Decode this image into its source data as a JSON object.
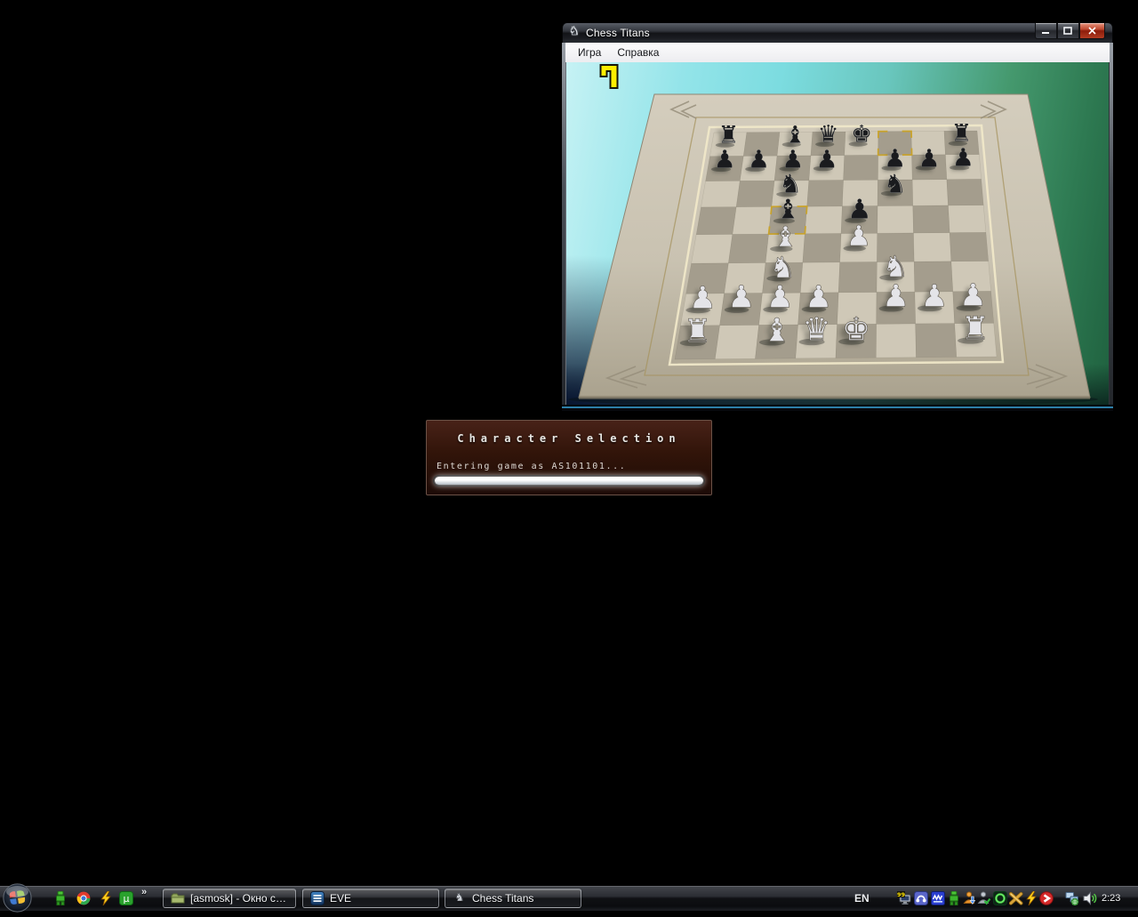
{
  "chess_window": {
    "title": "Chess Titans",
    "window_icon": "knight-icon",
    "menu_items": [
      {
        "label": "Игра"
      },
      {
        "label": "Справка"
      }
    ],
    "caption_buttons": [
      "minimize",
      "maximize",
      "close"
    ],
    "board": {
      "colors": {
        "light_square": "#cfc8b7",
        "dark_square": "#a49d8d",
        "table": "#c9c2b1",
        "frame_line": "#a5935f",
        "inner_line": "#efe7c8",
        "highlight_gold": "#c9a227"
      },
      "last_move_highlights": [
        "c5",
        "f8"
      ],
      "pieces": [
        {
          "square": "a1",
          "color": "white",
          "type": "rook"
        },
        {
          "square": "c1",
          "color": "white",
          "type": "bishop"
        },
        {
          "square": "d1",
          "color": "white",
          "type": "queen"
        },
        {
          "square": "e1",
          "color": "white",
          "type": "king"
        },
        {
          "square": "h1",
          "color": "white",
          "type": "rook"
        },
        {
          "square": "a2",
          "color": "white",
          "type": "pawn"
        },
        {
          "square": "b2",
          "color": "white",
          "type": "pawn"
        },
        {
          "square": "c2",
          "color": "white",
          "type": "pawn"
        },
        {
          "square": "d2",
          "color": "white",
          "type": "pawn"
        },
        {
          "square": "f2",
          "color": "white",
          "type": "pawn"
        },
        {
          "square": "g2",
          "color": "white",
          "type": "pawn"
        },
        {
          "square": "h2",
          "color": "white",
          "type": "pawn"
        },
        {
          "square": "c3",
          "color": "white",
          "type": "knight"
        },
        {
          "square": "f3",
          "color": "white",
          "type": "knight"
        },
        {
          "square": "c4",
          "color": "white",
          "type": "bishop"
        },
        {
          "square": "e4",
          "color": "white",
          "type": "pawn"
        },
        {
          "square": "c5",
          "color": "black",
          "type": "bishop"
        },
        {
          "square": "e5",
          "color": "black",
          "type": "pawn"
        },
        {
          "square": "c6",
          "color": "black",
          "type": "knight"
        },
        {
          "square": "f6",
          "color": "black",
          "type": "knight"
        },
        {
          "square": "a7",
          "color": "black",
          "type": "pawn"
        },
        {
          "square": "b7",
          "color": "black",
          "type": "pawn"
        },
        {
          "square": "c7",
          "color": "black",
          "type": "pawn"
        },
        {
          "square": "d7",
          "color": "black",
          "type": "pawn"
        },
        {
          "square": "f7",
          "color": "black",
          "type": "pawn"
        },
        {
          "square": "g7",
          "color": "black",
          "type": "pawn"
        },
        {
          "square": "h7",
          "color": "black",
          "type": "pawn"
        },
        {
          "square": "a8",
          "color": "black",
          "type": "rook"
        },
        {
          "square": "c8",
          "color": "black",
          "type": "bishop"
        },
        {
          "square": "d8",
          "color": "black",
          "type": "queen"
        },
        {
          "square": "e8",
          "color": "black",
          "type": "king"
        },
        {
          "square": "h8",
          "color": "black",
          "type": "rook"
        }
      ],
      "cursor_icon": "yellow-move-cursor-icon"
    }
  },
  "eve_dialog": {
    "title": "Character Selection",
    "status_text": "Entering game as AS101101...",
    "progress_percent": 100
  },
  "taskbar": {
    "start_button": {
      "icon": "windows-orb-icon"
    },
    "quick_launch": [
      {
        "icon": "green-figure-icon"
      },
      {
        "icon": "chrome-icon"
      },
      {
        "icon": "winamp-icon"
      },
      {
        "icon": "utorrent-icon"
      }
    ],
    "quick_launch_overflow": "»",
    "window_buttons": [
      {
        "label": "[asmosk] - Окно со...",
        "icon": "folder-icon"
      },
      {
        "label": "EVE",
        "icon": "eve-icon"
      },
      {
        "label": "Chess Titans",
        "icon": "knight-icon"
      }
    ],
    "tray": {
      "language": "EN",
      "icons": [
        "display-99-icon",
        "headphones-icon",
        "blue-badge-icon",
        "green-robot-icon",
        "user-download-icon",
        "user-check-icon",
        "green-ring-icon",
        "xfire-icon",
        "winamp-icon",
        "download-arrow-icon",
        "network-icon",
        "volume-icon"
      ],
      "clock": "2:23"
    }
  }
}
